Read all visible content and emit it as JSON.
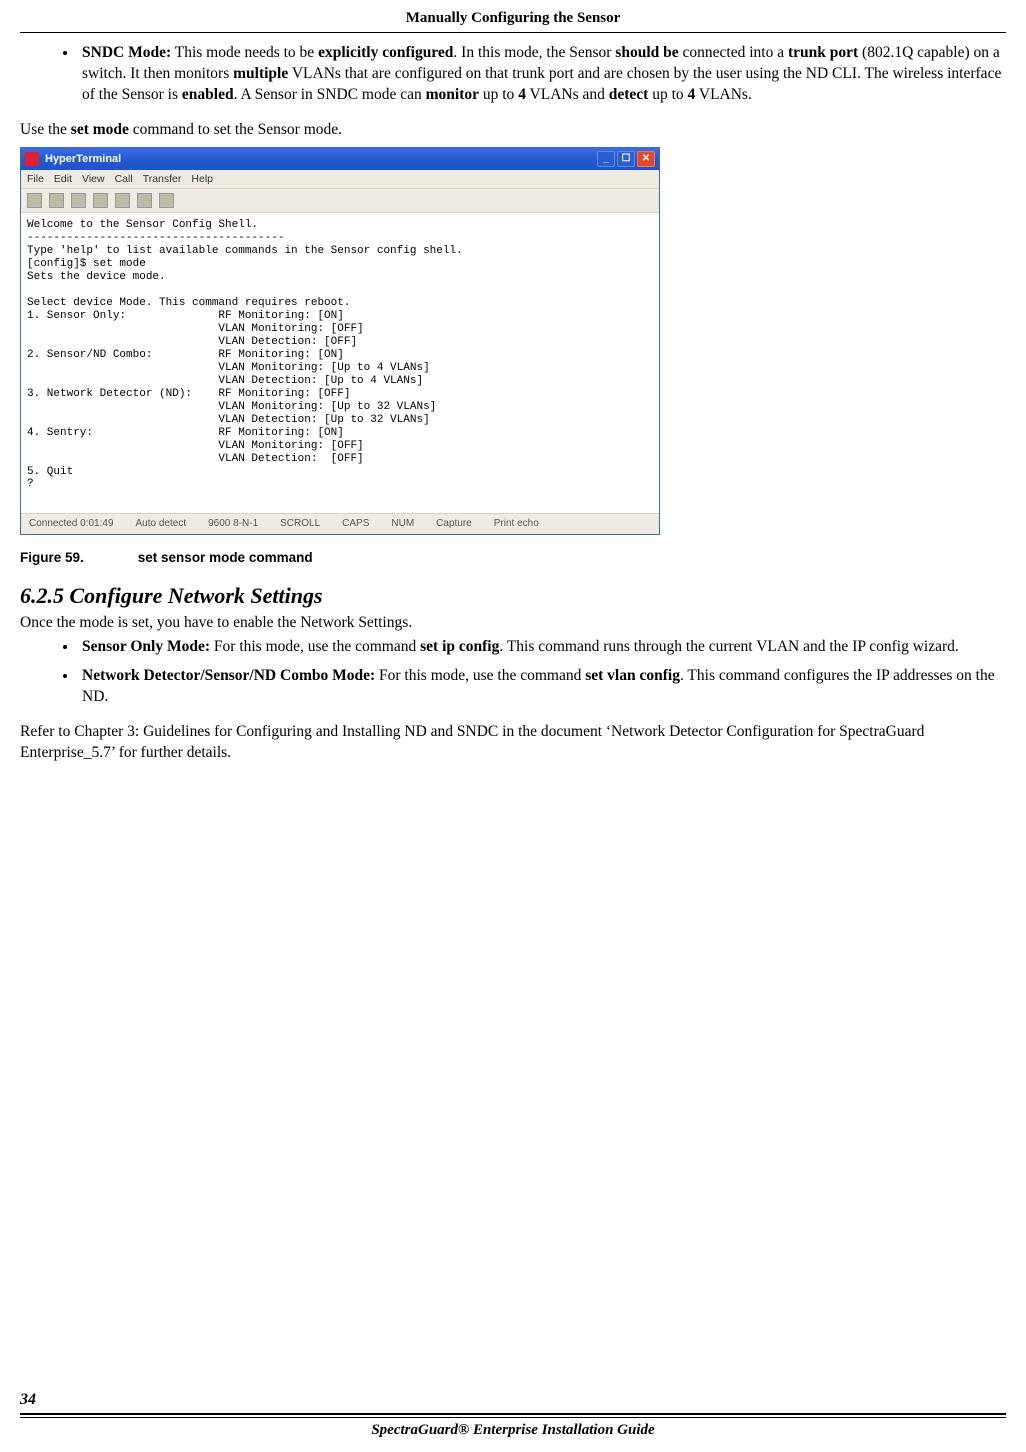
{
  "header": {
    "title": "Manually Configuring the Sensor"
  },
  "section1": {
    "item_label": "SNDC Mode:",
    "seg1": " This mode needs to be ",
    "b1": "explicitly configured",
    "seg2": ". In this mode, the Sensor ",
    "b2": "should be",
    "seg3": " connected into a ",
    "b3": "trunk port",
    "seg4": " (802.1Q capable) on a switch. It then monitors ",
    "b4": "multiple",
    "seg5": " VLANs that are configured on that trunk port and are chosen by the user using the ND CLI. The wireless interface of the Sensor is ",
    "b5": "enabled",
    "seg6": ". A Sensor in SNDC mode can ",
    "b6": "monitor",
    "seg7": " up to ",
    "b7": "4",
    "seg8": " VLANs and ",
    "b8": "detect",
    "seg9": " up to ",
    "b9": "4",
    "seg10": " VLANs."
  },
  "para1": {
    "seg1": "Use the ",
    "b1": "set mode",
    "seg2": " command to set the Sensor mode."
  },
  "terminal": {
    "title": "HyperTerminal",
    "menu": [
      "File",
      "Edit",
      "View",
      "Call",
      "Transfer",
      "Help"
    ],
    "console_text": "Welcome to the Sensor Config Shell.\n---------------------------------------\nType 'help' to list available commands in the Sensor config shell.\n[config]$ set mode\nSets the device mode.\n\nSelect device Mode. This command requires reboot.\n1. Sensor Only:              RF Monitoring: [ON]\n                             VLAN Monitoring: [OFF]\n                             VLAN Detection: [OFF]\n2. Sensor/ND Combo:          RF Monitoring: [ON]\n                             VLAN Monitoring: [Up to 4 VLANs]\n                             VLAN Detection: [Up to 4 VLANs]\n3. Network Detector (ND):    RF Monitoring: [OFF]\n                             VLAN Monitoring: [Up to 32 VLANs]\n                             VLAN Detection: [Up to 32 VLANs]\n4. Sentry:                   RF Monitoring: [ON]\n                             VLAN Monitoring: [OFF]\n                             VLAN Detection:  [OFF]\n5. Quit\n?",
    "status": [
      "Connected 0:01:49",
      "Auto detect",
      "9600 8-N-1",
      "SCROLL",
      "CAPS",
      "NUM",
      "Capture",
      "Print echo"
    ]
  },
  "figure": {
    "label": "Figure  59.",
    "caption": "set sensor mode command"
  },
  "section2": {
    "heading": "6.2.5   Configure Network Settings",
    "intro": "Once the mode is set, you have to enable the Network Settings.",
    "item1_label": "Sensor Only Mode:",
    "item1_seg1": " For this mode, use the command ",
    "item1_b1": "set ip config",
    "item1_seg2": ". This command runs through the current VLAN and the IP config wizard.",
    "item2_label": "Network Detector/Sensor/ND Combo Mode:",
    "item2_seg1": " For this mode, use the command ",
    "item2_b1": "set vlan config",
    "item2_seg2": ". This command configures the IP addresses on the ND."
  },
  "para2": "Refer to Chapter 3: Guidelines for Configuring and Installing ND and SNDC in the document ‘Network Detector Configuration for SpectraGuard Enterprise_5.7’ for further details.",
  "footer": {
    "page_number": "34",
    "title": "SpectraGuard® Enterprise Installation Guide"
  }
}
